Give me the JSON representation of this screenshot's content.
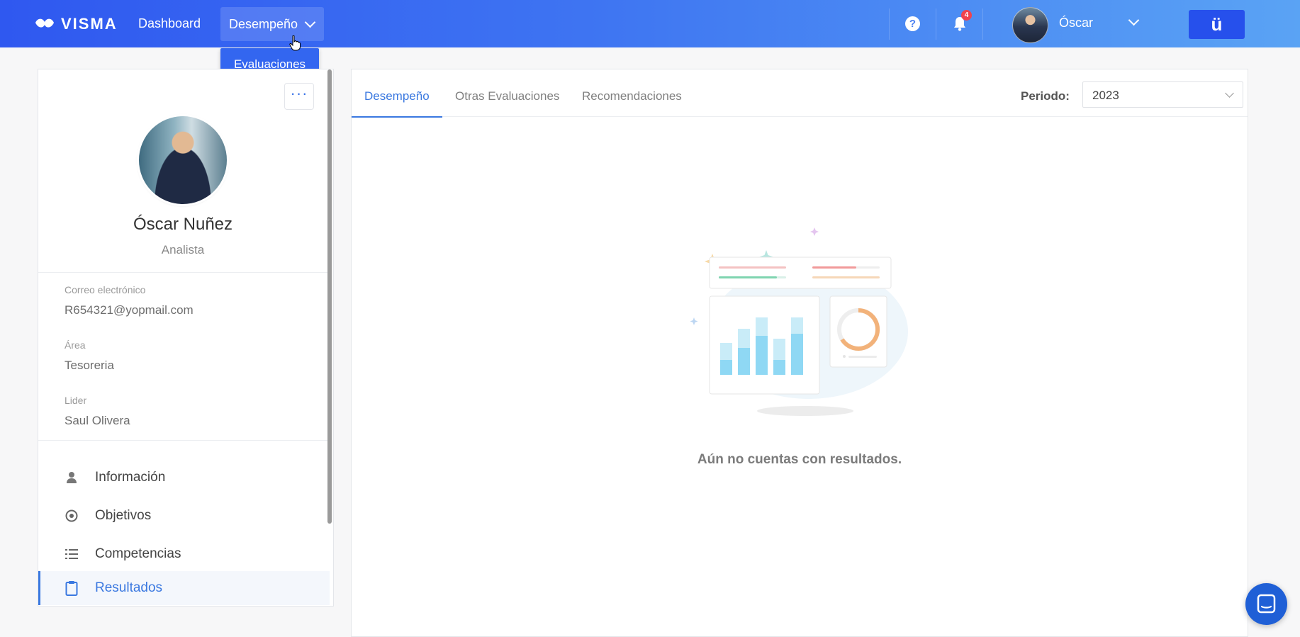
{
  "header": {
    "brand": "VISMA",
    "nav": {
      "dashboard": "Dashboard",
      "desempeno": "Desempeño"
    },
    "dropdown": {
      "evaluaciones": "Evaluaciones"
    },
    "help_symbol": "?",
    "notifications_count": "4",
    "user_name": "Óscar",
    "app_button_label": "ü"
  },
  "profile": {
    "name": "Óscar Nuñez",
    "role": "Analista",
    "more_symbol": "···",
    "fields": [
      {
        "label": "Correo electrónico",
        "value": "R654321@yopmail.com"
      },
      {
        "label": "Área",
        "value": "Tesoreria"
      },
      {
        "label": "Lider",
        "value": "Saul Olivera"
      }
    ]
  },
  "sidebar_menu": [
    {
      "label": "Información",
      "icon": "person-icon",
      "active": false
    },
    {
      "label": "Objetivos",
      "icon": "target-icon",
      "active": false
    },
    {
      "label": "Competencias",
      "icon": "list-icon",
      "active": false
    },
    {
      "label": "Resultados",
      "icon": "clipboard-icon",
      "active": true
    }
  ],
  "main": {
    "tabs": [
      {
        "label": "Desempeño",
        "active": true
      },
      {
        "label": "Otras Evaluaciones",
        "active": false
      },
      {
        "label": "Recomendaciones",
        "active": false
      }
    ],
    "periodo_label": "Periodo:",
    "periodo_value": "2023",
    "empty_message": "Aún no cuentas con resultados."
  },
  "colors": {
    "accent": "#3a78e0",
    "header_start": "#2f58f0",
    "header_end": "#5aa3f4",
    "badge": "#f0434d"
  }
}
